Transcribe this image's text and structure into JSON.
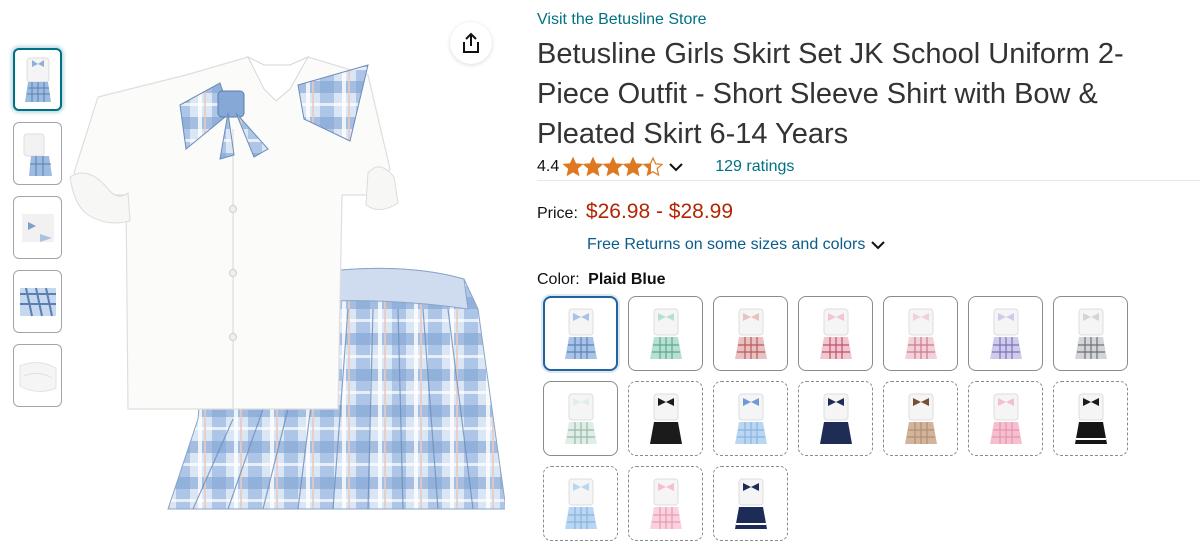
{
  "product": {
    "store_link": "Visit the Betusline Store",
    "title": "Betusline Girls Skirt Set JK School Uniform 2-Piece Outfit - Short Sleeve Shirt with Bow & Pleated Skirt 6-14 Years",
    "rating_value": "4.4",
    "rating_stars": 4.4,
    "ratings_count": "129 ratings",
    "price_label": "Price:",
    "price_range": "$26.98 - $28.99",
    "returns_text": "Free Returns on some sizes and colors",
    "color_label": "Color:",
    "color_selected": "Plaid Blue"
  },
  "colors": {
    "link": "#007185",
    "price": "#b12704",
    "star": "#de7921",
    "selected_border": "#2162a1"
  },
  "icons": [
    "share-icon",
    "star-icon",
    "chevron-down-icon"
  ],
  "thumbnails": [
    {
      "name": "front-outfit",
      "active": true
    },
    {
      "name": "outfit-detail",
      "active": false
    },
    {
      "name": "bow-detail",
      "active": false
    },
    {
      "name": "skirt-pleats",
      "active": false
    },
    {
      "name": "fabric-closeup",
      "active": false
    }
  ],
  "swatches": [
    {
      "skirt": "blue-plaid",
      "bow": "blue-plaid",
      "selected": true,
      "available": true
    },
    {
      "skirt": "green-plaid",
      "bow": "green-plaid",
      "selected": false,
      "available": true
    },
    {
      "skirt": "red-plaid",
      "bow": "red-plaid",
      "selected": false,
      "available": true
    },
    {
      "skirt": "pink-red-plaid",
      "bow": "pink-red-plaid",
      "selected": false,
      "available": true
    },
    {
      "skirt": "pink-plaid",
      "bow": "pink-plaid",
      "selected": false,
      "available": true
    },
    {
      "skirt": "purple-plaid",
      "bow": "purple-plaid",
      "selected": false,
      "available": true
    },
    {
      "skirt": "grey-plaid",
      "bow": "grey-plaid",
      "selected": false,
      "available": true
    },
    {
      "skirt": "mint-plaid",
      "bow": "mint-plaid",
      "selected": false,
      "available": true
    },
    {
      "skirt": "black",
      "bow": "black",
      "selected": false,
      "available": false
    },
    {
      "skirt": "light-blue",
      "bow": "blue",
      "selected": false,
      "available": false
    },
    {
      "skirt": "navy",
      "bow": "navy",
      "selected": false,
      "available": false
    },
    {
      "skirt": "khaki",
      "bow": "brown",
      "selected": false,
      "available": false
    },
    {
      "skirt": "pink",
      "bow": "pink",
      "selected": false,
      "available": false
    },
    {
      "skirt": "black-white-stripe",
      "bow": "black",
      "selected": false,
      "available": false
    },
    {
      "skirt": "light-blue",
      "bow": "light-blue",
      "selected": false,
      "available": false
    },
    {
      "skirt": "light-pink",
      "bow": "pink",
      "selected": false,
      "available": false
    },
    {
      "skirt": "navy-white-stripe",
      "bow": "navy",
      "selected": false,
      "available": false
    }
  ]
}
